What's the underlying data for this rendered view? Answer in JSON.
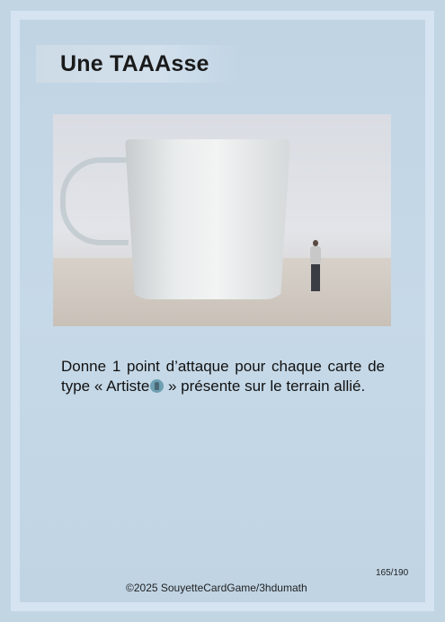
{
  "card": {
    "title": "Une TAAAsse",
    "effect_before_icon": "Donne 1 point d’attaque pour chaque carte de type « Artiste",
    "effect_after_icon": " » présente sur le terrain allié.",
    "type_icon": "artist-type-icon",
    "card_number": "165/190",
    "copyright": "©2025 SouyetteCardGame/3hdumath"
  },
  "colors": {
    "background": "#c1d5e3",
    "frame": "#d6e3f1",
    "icon": "#6e9fb2"
  }
}
